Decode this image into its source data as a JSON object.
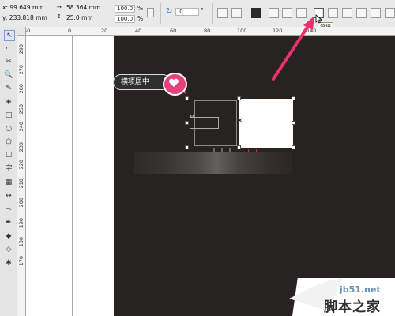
{
  "property_bar": {
    "x_value": "x: 99.649 mm",
    "y_value": "y: 233.818 mm",
    "width_value": "58.364 mm",
    "height_value": "25.0 mm",
    "scale_x": "100.0",
    "scale_y": "100.0",
    "percent_sign": "%",
    "rotation_value": ".0",
    "degree_sign": "°"
  },
  "tooltip": {
    "text": "简接"
  },
  "callout": {
    "text": "横项居中"
  },
  "ruler": {
    "h_labels": [
      "40",
      "0",
      "20",
      "40",
      "60",
      "80",
      "100",
      "120",
      "140"
    ],
    "v_labels": [
      "290",
      "270",
      "260",
      "250",
      "240",
      "230",
      "220",
      "210",
      "200",
      "190",
      "180",
      "170"
    ]
  },
  "watermark": {
    "site": "jb51.net",
    "name": "脚本之家"
  },
  "colors": {
    "accent": "#e6417c",
    "canvas_dark": "#262320",
    "callout_bg": "#2f2f2f"
  },
  "icons": {
    "toolbox": [
      "pick-icon",
      "shape-icon",
      "crop-icon",
      "zoom-icon",
      "freehand-icon",
      "smart-fill-icon",
      "rectangle-icon",
      "ellipse-icon",
      "polygon-icon",
      "basic-shapes-icon",
      "text-icon",
      "table-icon",
      "dimension-icon",
      "connector-icon",
      "eyedropper-icon",
      "fill-icon",
      "outline-icon",
      "smart-drawing-icon"
    ],
    "toolbox_glyphs": [
      "↖",
      "⌐",
      "✂",
      "🔍",
      "✎",
      "◈",
      "□",
      "○",
      "⬠",
      "☐",
      "字",
      "▦",
      "↔",
      "⤳",
      "✒",
      "◆",
      "◇",
      "✱"
    ]
  }
}
